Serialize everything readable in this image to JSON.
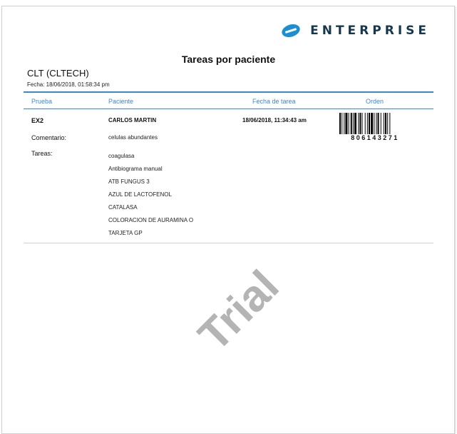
{
  "header": {
    "logo_text": "ENTERPRISE",
    "logo_icon": "enterprise-e-icon",
    "title": "Tareas por paciente",
    "lab_name": "CLT (CLTECH)",
    "date_line": "Fecha: 18/06/2018, 01:58:34 pm"
  },
  "table": {
    "columns": [
      "Prueba",
      "Paciente",
      "Fecha de tarea",
      "Orden"
    ],
    "row": {
      "test": "EX2",
      "patient": "CARLOS MARTIN",
      "task_date": "18/06/2018, 11:34:43 am",
      "order_number": "806143271",
      "comment_label": "Comentario:",
      "comment": "celulas abundantes",
      "tasks_label": "Tareas:",
      "tasks": [
        "coagulasa",
        "Antibiograma manual",
        "ATB FUNGUS 3",
        "AZUL DE LACTOFENOL",
        "CATALASA",
        "COLORACION DE AURAMINA O",
        "TARJETA GP"
      ]
    }
  },
  "watermark": "Trial",
  "colors": {
    "accent": "#3a89c9",
    "brand": "#16384f",
    "watermark": "#b4b4b4"
  }
}
